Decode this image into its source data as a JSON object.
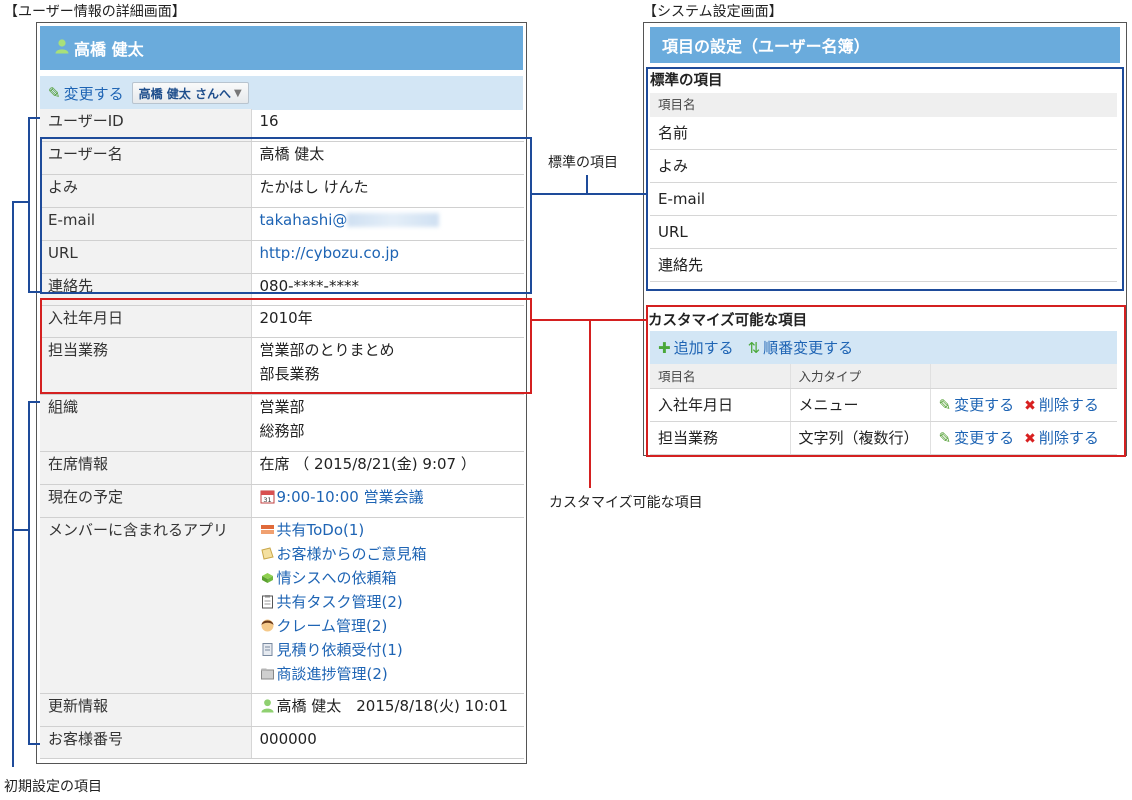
{
  "captions": {
    "left_title": "【ユーザー情報の詳細画面】",
    "right_title": "【システム設定画面】",
    "standard_items": "標準の項目",
    "custom_items": "カスタマイズ可能な項目",
    "initial_items": "初期設定の項目"
  },
  "user_detail": {
    "header_name": "高橋 健太",
    "toolbar": {
      "edit_label": "変更する",
      "dropdown_label": "高橋 健太 さんへ"
    },
    "rows": [
      {
        "label": "ユーザーID",
        "value": "16"
      },
      {
        "label": "ユーザー名",
        "value": "高橋 健太"
      },
      {
        "label": "よみ",
        "value": "たかはし けんた"
      },
      {
        "label": "E-mail",
        "value": "takahashi@"
      },
      {
        "label": "URL",
        "value": "http://cybozu.co.jp"
      },
      {
        "label": "連絡先",
        "value": "080-****-****"
      },
      {
        "label": "入社年月日",
        "value": "2010年"
      },
      {
        "label": "担当業務",
        "value_lines": [
          "営業部のとりまとめ",
          "部長業務"
        ]
      },
      {
        "label": "組織",
        "value_lines": [
          "営業部",
          "総務部"
        ]
      },
      {
        "label": "在席情報",
        "value": "在席 （ 2015/8/21(金) 9:07 ）"
      },
      {
        "label": "現在の予定",
        "value": "9:00-10:00 営業会議"
      },
      {
        "label": "メンバーに含まれるアプリ",
        "apps": [
          {
            "name": "共有ToDo(1)",
            "icon": "todo-icon"
          },
          {
            "name": "お客様からのご意見箱",
            "icon": "memo-icon"
          },
          {
            "name": "情シスへの依頼箱",
            "icon": "cube-icon"
          },
          {
            "name": "共有タスク管理(2)",
            "icon": "clipboard-icon"
          },
          {
            "name": "クレーム管理(2)",
            "icon": "person-icon"
          },
          {
            "name": "見積り依頼受付(1)",
            "icon": "document-icon"
          },
          {
            "name": "商談進捗管理(2)",
            "icon": "folder-icon"
          }
        ]
      },
      {
        "label": "更新情報",
        "value": "高橋 健太　2015/8/18(火) 10:01"
      },
      {
        "label": "お客様番号",
        "value": "000000"
      }
    ]
  },
  "system_settings": {
    "header": "項目の設定（ユーザー名簿）",
    "standard": {
      "title": "標準の項目",
      "column_header": "項目名",
      "items": [
        "名前",
        "よみ",
        "E-mail",
        "URL",
        "連絡先"
      ]
    },
    "custom": {
      "title": "カスタマイズ可能な項目",
      "add_label": "追加する",
      "reorder_label": "順番変更する",
      "columns": [
        "項目名",
        "入力タイプ"
      ],
      "rows": [
        {
          "name": "入社年月日",
          "type": "メニュー",
          "edit": "変更する",
          "delete": "削除する"
        },
        {
          "name": "担当業務",
          "type": "文字列（複数行）",
          "edit": "変更する",
          "delete": "削除する"
        }
      ]
    }
  },
  "colors": {
    "header_blue": "#6aabdc",
    "toolbar_blue": "#d3e6f5",
    "link": "#1e64b4",
    "annotation_blue": "#1e4b9a",
    "annotation_red": "#d42020"
  }
}
